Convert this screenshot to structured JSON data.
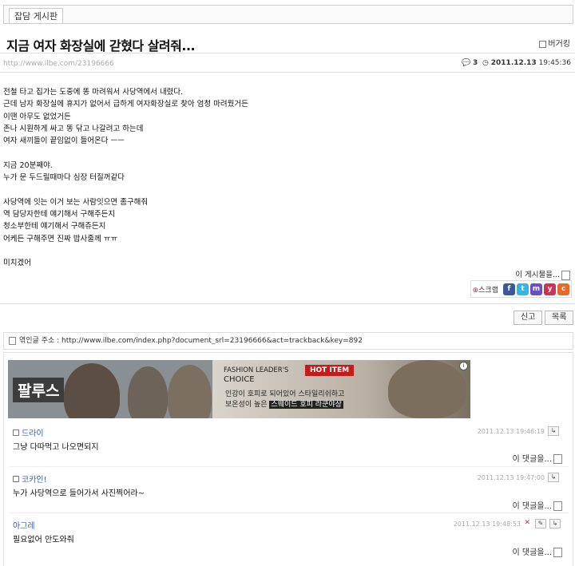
{
  "board": {
    "tab_label": "잡담 게시판"
  },
  "post": {
    "title": "지금 여자 화장실에 갇혔다 살려줘...",
    "author": "버거킹",
    "url": "http://www.ilbe.com/23196666",
    "comment_count": "3",
    "date": "2011.12.13",
    "time": "19:45:36",
    "body": "전철 타고 집가는 도중에 똥 마려워서 사당역에서 내렸다.\n근데 남자 화장실에 휴지가 없어서 급하게 여자화장실로 찾아 엄청 마려웠거든\n이땐 아무도 없었거든\n존나 시원하게 싸고 똥 닦고 나갈려고 하는데\n여자 새끼들이 끝임없이 들어온다 ㅡㅡ\n\n지금 20분째야.\n누가 문 두드릴때마다 심장 터질꺼같다\n\n사당역에 잇는 이거 보는 사람잇으면 좀구해줘\n역 담당자한테 얘기해서 구해주든지\n청소부한테 얘기해서 구해쥬든지\n어케든 구해주면 진짜 밥사줄께 ㅠㅠ\n\n미치겠어",
    "post_action": "이 게시물을...",
    "scrap_label": "스크랩"
  },
  "buttons": {
    "report": "신고",
    "list": "목록"
  },
  "trackback": {
    "label": "엮인글 주소 : http://www.ilbe.com/index.php?document_srl=23196666&act=trackback&key=892"
  },
  "ad": {
    "brand": "팔루스",
    "fashion_line1": "FASHION LEADER'S",
    "fashion_line2": "CHOICE",
    "hot_item": "HOT ITEM",
    "copy_line1": "인강이 호피로 되어있어 스타일리쉬하고",
    "copy_line2_pre": "보온성이 높은 ",
    "copy_line2_highlight": "스웨이드 호피 라쿤야상",
    "info": "i"
  },
  "comments": [
    {
      "author": "드라이",
      "date": "2011.12.13 19:46:19",
      "text": "그냥 다따먹고 나오면되지",
      "action": "이 댓글을..."
    },
    {
      "author": "코카인!",
      "date": "2011.12.13 19:47:00",
      "text": "누가 사당역으로 들어가서 사진찍어라~",
      "action": "이 댓글을..."
    },
    {
      "author": "아그레",
      "date": "2011.12.13 19:48:53",
      "text": "필요없어 안도와줘",
      "action": "이 댓글을..."
    }
  ],
  "colors": {
    "author_link": "#3a5aa8",
    "hot_item": "#c21d1d",
    "border": "#dddddd"
  }
}
